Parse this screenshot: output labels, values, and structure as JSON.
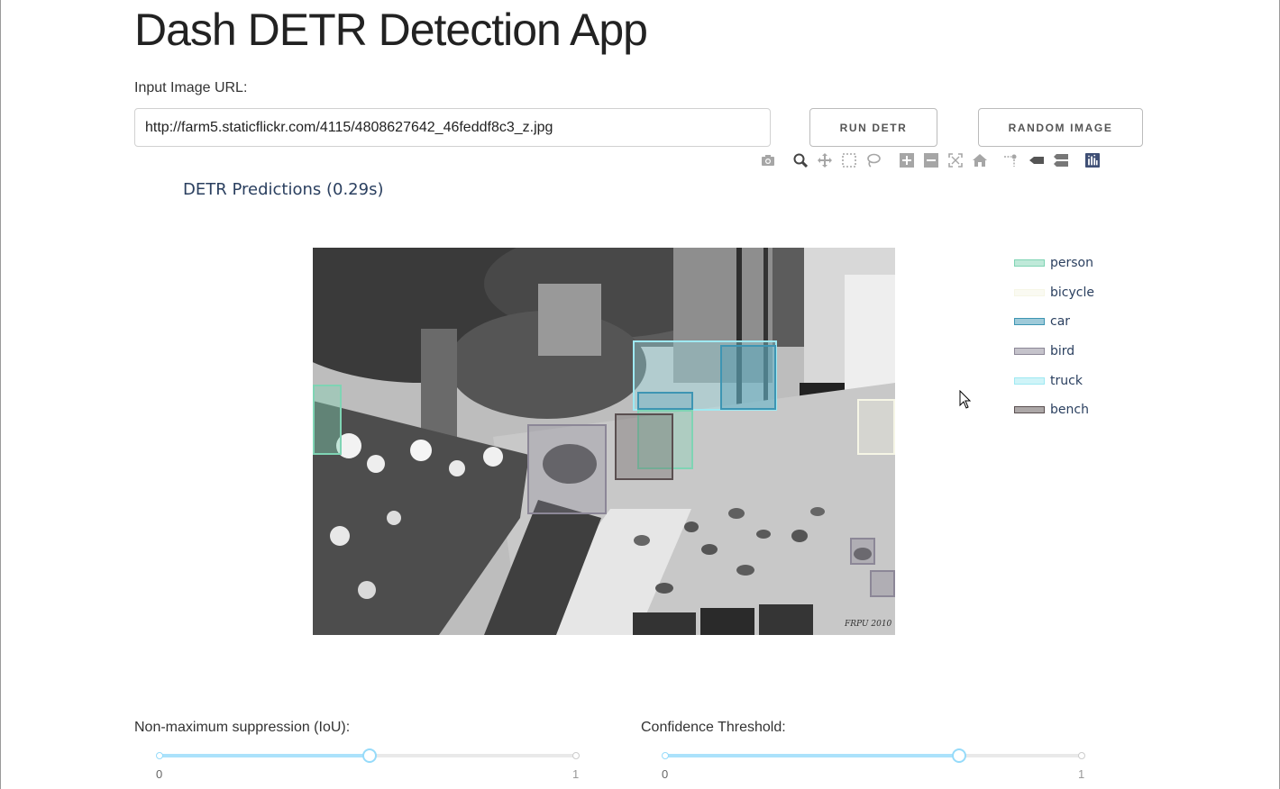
{
  "header": {
    "title": "Dash DETR Detection App"
  },
  "input": {
    "label": "Input Image URL:",
    "value": "http://farm5.staticflickr.com/4115/4808627642_46feddf8c3_z.jpg"
  },
  "buttons": {
    "run_label": "RUN DETR",
    "random_label": "RANDOM IMAGE"
  },
  "modebar": [
    {
      "name": "camera-icon"
    },
    {
      "name": "zoom-icon",
      "active": true
    },
    {
      "name": "pan-icon"
    },
    {
      "name": "box-select-icon"
    },
    {
      "name": "lasso-select-icon"
    },
    {
      "name": "zoom-in-icon"
    },
    {
      "name": "zoom-out-icon"
    },
    {
      "name": "autoscale-icon"
    },
    {
      "name": "reset-axes-icon"
    },
    {
      "name": "toggle-spike-lines-icon"
    },
    {
      "name": "show-closest-icon"
    },
    {
      "name": "compare-data-icon"
    },
    {
      "name": "plotly-logo-icon"
    }
  ],
  "figure": {
    "title": "DETR Predictions (0.29s)",
    "watermark": "FRPU 2010",
    "legend": [
      {
        "label": "person",
        "color": "#7fd4b4"
      },
      {
        "label": "bicycle",
        "color": "#f6f6e6"
      },
      {
        "label": "car",
        "color": "#3e95b3"
      },
      {
        "label": "bird",
        "color": "#8c8797"
      },
      {
        "label": "truck",
        "color": "#9fe9f2"
      },
      {
        "label": "bench",
        "color": "#5a4f50"
      }
    ]
  },
  "sliders": {
    "nms": {
      "label": "Non-maximum suppression (IoU):",
      "min_label": "0",
      "max_label": "1",
      "value": 0.5
    },
    "confidence": {
      "label": "Confidence Threshold:",
      "min_label": "0",
      "max_label": "1",
      "value": 0.7
    }
  }
}
